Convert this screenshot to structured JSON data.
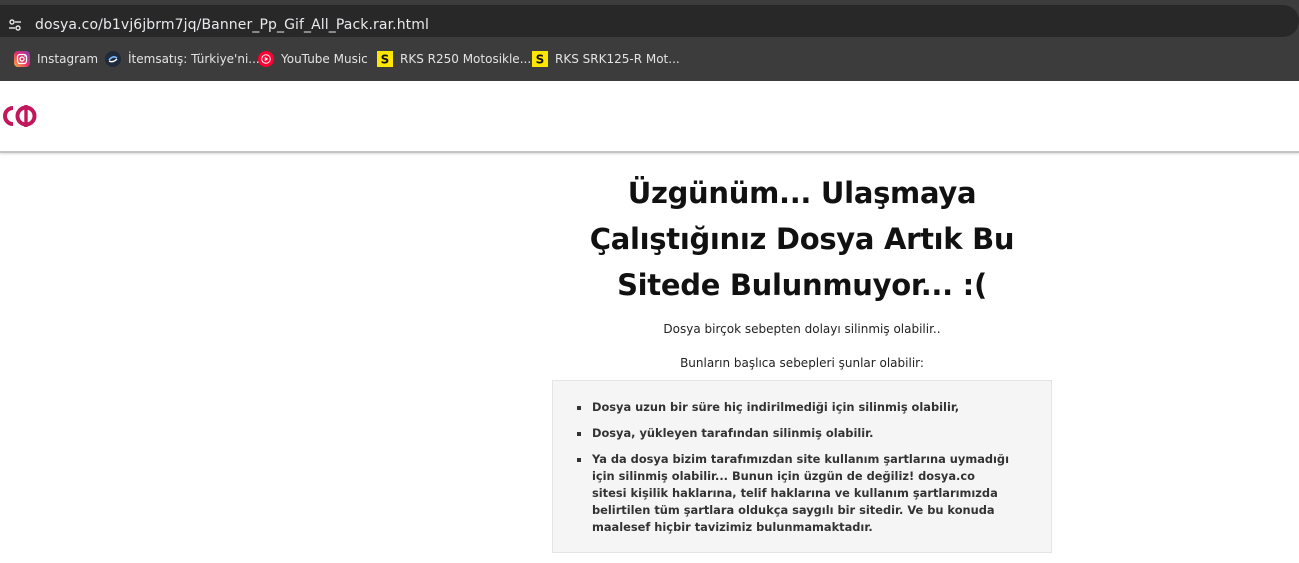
{
  "browser": {
    "url": "dosya.co/b1vj6jbrm7jq/Banner_Pp_Gif_All_Pack.rar.html",
    "bookmarks": [
      {
        "label": "Instagram",
        "icon": "instagram-icon"
      },
      {
        "label": "İtemsatış: Türkiye'ni...",
        "icon": "itemsatis-icon"
      },
      {
        "label": "YouTube Music",
        "icon": "youtube-music-icon"
      },
      {
        "label": "RKS R250 Motosikle...",
        "icon": "rks-icon"
      },
      {
        "label": "RKS SRK125-R Mot...",
        "icon": "rks-icon"
      }
    ]
  },
  "page": {
    "logo_icon": "dosya-co-logo",
    "headline": "Üzgünüm... Ulaşmaya Çalıştığınız Dosya Artık Bu Sitede Bulunmuyor... :(",
    "subtitle1": "Dosya birçok sebepten dolayı silinmiş olabilir..",
    "subtitle2": "Bunların başlıca sebepleri şunlar olabilir:",
    "reasons": [
      "Dosya uzun bir süre hiç indirilmediği için silinmiş olabilir,",
      "Dosya, yükleyen tarafından silinmiş olabilir.",
      "Ya da dosya bizim tarafımızdan site kullanım şartlarına uymadığı için silinmiş olabilir... Bunun için üzgün de değiliz! dosya.co sitesi kişilik haklarına, telif haklarına ve kullanım şartlarımızda belirtilen tüm şartlara oldukça saygılı bir sitedir. Ve bu konuda maalesef hiçbir tavizimiz bulunmamaktadır."
    ]
  },
  "colors": {
    "browser_bg": "#3c3c3c",
    "logo_magenta": "#c2185b",
    "rks_yellow": "#ffe600",
    "youtube_red": "#ff0033"
  }
}
